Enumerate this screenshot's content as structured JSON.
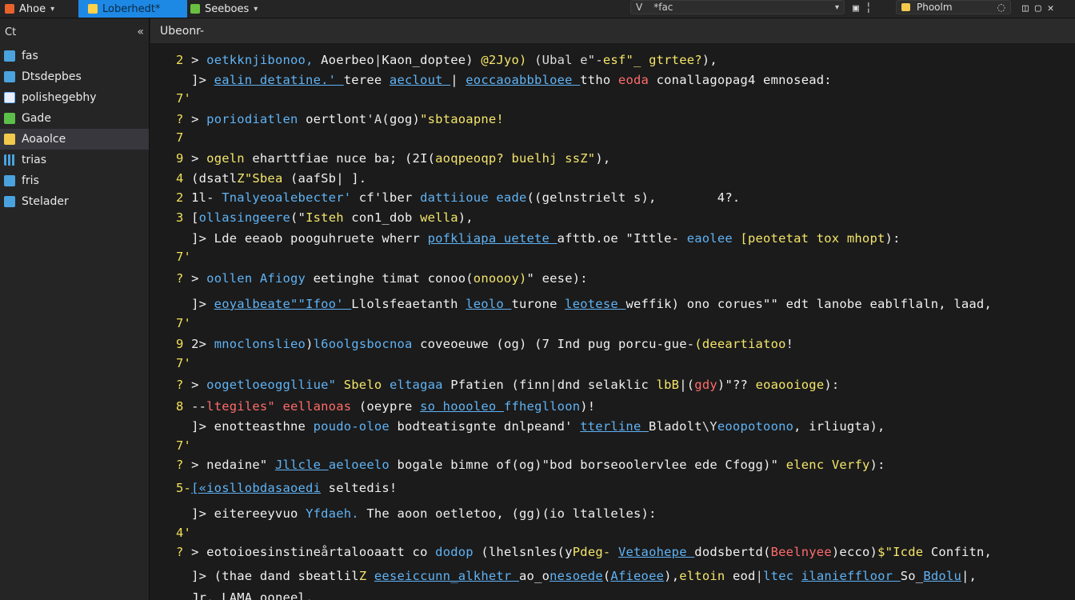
{
  "topbar": {
    "tabs": [
      {
        "label": "Ahoe",
        "color": "#e8622c"
      },
      {
        "label": "Loberhedt*",
        "color": "#ffd24a"
      },
      {
        "label": "Seeboes",
        "color": "#6abf40"
      }
    ],
    "search": {
      "prefix": "V",
      "placeholder": "*fac"
    },
    "branch": {
      "label": "Phoolm"
    }
  },
  "sidebar": {
    "header": "Ct",
    "items": [
      {
        "label": "fas",
        "color": "#4aa3df"
      },
      {
        "label": "Dtsdepbes",
        "color": "#4aa3df"
      },
      {
        "label": "polishegebhy",
        "color": "#6fb3ff"
      },
      {
        "label": "Gade",
        "color": "#5cbf4a"
      },
      {
        "label": "Aoaolce",
        "color": "#f2c94c"
      },
      {
        "label": "trias",
        "color": "#4aa3df"
      },
      {
        "label": "fris",
        "color": "#4aa3df"
      },
      {
        "label": "Stelader",
        "color": "#4aa3df"
      }
    ]
  },
  "editor": {
    "title": "Ubeonr-",
    "lines": [
      [
        [
          "ln",
          "2 "
        ],
        [
          "w",
          "> "
        ],
        [
          "b",
          "oetkknjibonoo, "
        ],
        [
          "w",
          "Aoerbeo"
        ],
        [
          "g",
          "|"
        ],
        [
          "w",
          "Kaon_doptee) "
        ],
        [
          "y",
          "@2Jyo) "
        ],
        [
          "g",
          "(Ubal e\"-"
        ],
        [
          "y",
          "esf\"_ gtrtee?"
        ],
        [
          "w",
          "),"
        ]
      ],
      [
        [
          "w",
          "  ]> "
        ],
        [
          "b",
          "ealin detatine.' "
        ],
        [
          "w",
          "teree "
        ],
        [
          "b",
          "aeclout "
        ],
        [
          "w",
          "| "
        ],
        [
          "b",
          "eoccaoabbbloee "
        ],
        [
          "w",
          "ttho "
        ],
        [
          "r",
          "eoda "
        ],
        [
          "w",
          "conallagopag4 "
        ],
        [
          "w",
          "emnosead:"
        ]
      ],
      [
        [
          "ln",
          "7'"
        ]
      ],
      [
        [
          "ln",
          "? "
        ],
        [
          "w",
          "> "
        ],
        [
          "b",
          "poriodiatlen "
        ],
        [
          "w",
          "oertlont"
        ],
        [
          "g",
          "'A"
        ],
        [
          "w",
          "(gog)"
        ],
        [
          "y",
          "\"sbtaoapne!"
        ]
      ],
      [
        [
          "ln",
          "7"
        ]
      ],
      [
        [
          "ln",
          "9 "
        ],
        [
          "w",
          "> "
        ],
        [
          "y",
          "ogeln "
        ],
        [
          "w",
          "eharttfiae nuce ba; "
        ],
        [
          "w",
          "(2I("
        ],
        [
          "y",
          "aoqpeoqp? buelhj ssZ\""
        ],
        [
          "w",
          "),"
        ]
      ],
      [
        [
          "ln",
          "4 "
        ],
        [
          "w",
          "(dsatl"
        ],
        [
          "y",
          "Z\"Sbea "
        ],
        [
          "w",
          "(aafSb| ]."
        ]
      ],
      [
        [
          "ln",
          "2 "
        ],
        [
          "w",
          "1l- "
        ],
        [
          "b",
          "Tnalyeoalebecter' "
        ],
        [
          "w",
          "cf'lber "
        ],
        [
          "b",
          "dattiioue eade"
        ],
        [
          "w",
          "((gelnstrielt s),        4?."
        ]
      ],
      [
        [
          "ln",
          "3 "
        ],
        [
          "w",
          "["
        ],
        [
          "b",
          "ollasingeere"
        ],
        [
          "w",
          "(\""
        ],
        [
          "y",
          "Isteh "
        ],
        [
          "w",
          "con1_dob "
        ],
        [
          "y",
          "wella"
        ],
        [
          "w",
          "),"
        ]
      ],
      [
        [
          "w",
          "  ]> "
        ],
        [
          "w",
          "Lde "
        ],
        [
          "w",
          "eeaob pooguhruete wherr "
        ],
        [
          "b",
          "pofkliapa uetete "
        ],
        [
          "w",
          "afttb.oe "
        ],
        [
          "w",
          "\"Ittle- "
        ],
        [
          "b",
          "eaolee "
        ],
        [
          "y",
          "[peotetat tox mhopt"
        ],
        [
          "w",
          "):"
        ]
      ],
      [
        [
          "ln",
          "7'"
        ]
      ],
      [
        [
          "ln",
          "? "
        ],
        [
          "w",
          "> "
        ],
        [
          "b",
          "oollen Afiogy "
        ],
        [
          "w",
          "eetinghe timat "
        ],
        [
          "w",
          "conoo("
        ],
        [
          "y",
          "onoooy)"
        ],
        [
          "w",
          "\" eese):"
        ]
      ],
      [
        [
          "w",
          "  ]> "
        ],
        [
          "b",
          "eoyalbeate\"\"Ifoo' "
        ],
        [
          "w",
          "Llolsfeaetanth "
        ],
        [
          "b",
          "leolo "
        ],
        [
          "w",
          "turone "
        ],
        [
          "b",
          "leotese "
        ],
        [
          "w",
          "weffik) ono "
        ],
        [
          "w",
          "corues\"\" "
        ],
        [
          "w",
          "edt lanobe eablflaln, laad,"
        ]
      ],
      [
        [
          "ln",
          "7'"
        ]
      ],
      [
        [
          "ln",
          "9 "
        ],
        [
          "w",
          "2> "
        ],
        [
          "b",
          "mnoclonslieo"
        ],
        [
          "w",
          ")"
        ],
        [
          "b",
          "l6oolgsbocnoa "
        ],
        [
          "w",
          "coveoeuwe "
        ],
        [
          "w",
          "(og) "
        ],
        [
          "w",
          "(7 Ind "
        ],
        [
          "w",
          "pug "
        ],
        [
          "w",
          "porcu-gue-"
        ],
        [
          "y",
          "(deeartiatoo"
        ],
        [
          "w",
          "!"
        ]
      ],
      [
        [
          "ln",
          "7'"
        ]
      ],
      [
        [
          "ln",
          "? "
        ],
        [
          "w",
          "> "
        ],
        [
          "b",
          "oogetloeogglliue\" "
        ],
        [
          "y",
          "Sbelo "
        ],
        [
          "b",
          "eltagaa "
        ],
        [
          "w",
          "Pfatien "
        ],
        [
          "w",
          "(finn"
        ],
        [
          "g",
          "|"
        ],
        [
          "w",
          "dnd selaklic "
        ],
        [
          "y",
          "lbB"
        ],
        [
          "w",
          "|("
        ],
        [
          "r",
          "gdy"
        ],
        [
          "w",
          ")\"?? "
        ],
        [
          "y",
          "eoaooioge"
        ],
        [
          "w",
          "):"
        ]
      ],
      [
        [
          "ln",
          "8 "
        ],
        [
          "w",
          "--"
        ],
        [
          "r",
          "ltegiles\" "
        ],
        [
          "r",
          "eellanoas "
        ],
        [
          "w",
          "(oeypre "
        ],
        [
          "b",
          "so hoooleo "
        ],
        [
          "b",
          "ffheglloon"
        ],
        [
          "w",
          ")!"
        ]
      ],
      [
        [
          "w",
          "  ]> "
        ],
        [
          "w",
          "enotteasthne "
        ],
        [
          "b",
          "poudo-oloe "
        ],
        [
          "w",
          "bodteatisgnte "
        ],
        [
          "w",
          "dnlpeand' "
        ],
        [
          "b",
          "tterline "
        ],
        [
          "w",
          "Bladolt"
        ],
        [
          "g",
          "\\Y"
        ],
        [
          "b",
          "eoopotoono"
        ],
        [
          "w",
          ", irliugta),"
        ]
      ],
      [
        [
          "ln",
          "7'"
        ]
      ],
      [
        [
          "ln",
          "? "
        ],
        [
          "w",
          "> "
        ],
        [
          "w",
          "nedaine\" "
        ],
        [
          "b",
          "Jllcle "
        ],
        [
          "b",
          "aeloeelo "
        ],
        [
          "w",
          "bogale "
        ],
        [
          "w",
          "bimne "
        ],
        [
          "w",
          "of(og)"
        ],
        [
          "w",
          "\"bod "
        ],
        [
          "w",
          "borseoolervlee "
        ],
        [
          "w",
          "ede "
        ],
        [
          "w",
          "Cfogg)\" "
        ],
        [
          "y",
          "elenc Verfy"
        ],
        [
          "w",
          "):"
        ]
      ],
      [
        [
          "ln",
          "5-"
        ],
        [
          "b",
          "[«iosllobdasaoedi"
        ],
        [
          "w",
          " seltedis!"
        ]
      ],
      [
        [
          "w",
          "  ]> "
        ],
        [
          "w",
          "eitereeyvuo "
        ],
        [
          "b",
          "Yfdaeh. "
        ],
        [
          "w",
          "The "
        ],
        [
          "w",
          "aoon "
        ],
        [
          "w",
          "oetletoo, "
        ],
        [
          "w",
          "(gg)"
        ],
        [
          "w",
          "(io "
        ],
        [
          "w",
          "ltalleles):"
        ]
      ],
      [
        [
          "ln",
          "4'"
        ]
      ],
      [
        [
          "ln",
          "? "
        ],
        [
          "w",
          "> "
        ],
        [
          "w",
          "eotoioesinstine"
        ],
        [
          "g",
          "å"
        ],
        [
          "w",
          "rtalooaatt "
        ],
        [
          "w",
          "co "
        ],
        [
          "b",
          "dodop "
        ],
        [
          "w",
          "(lhelsnles(y"
        ],
        [
          "y",
          "Pdeg- "
        ],
        [
          "b",
          "Vetaohepe "
        ],
        [
          "w",
          "dodsbertd("
        ],
        [
          "r",
          "Beelnyee"
        ],
        [
          "w",
          ")ecco)"
        ],
        [
          "y",
          "$\"Icde "
        ],
        [
          "w",
          "Confitn,"
        ]
      ],
      [
        [
          "w",
          "  ]> "
        ],
        [
          "w",
          "(thae "
        ],
        [
          "w",
          "dand "
        ],
        [
          "w",
          "sbeatlil"
        ],
        [
          "y",
          "Z "
        ],
        [
          "b",
          "eeseiccunn_alkhetr "
        ],
        [
          "w",
          "ao_o"
        ],
        [
          "b",
          "nesoede"
        ],
        [
          "w",
          "("
        ],
        [
          "b",
          "Afieoee"
        ],
        [
          "w",
          "),"
        ],
        [
          "y",
          "eltoin "
        ],
        [
          "w",
          "eod"
        ],
        [
          "g",
          "|"
        ],
        [
          "b",
          "ltec "
        ],
        [
          "b",
          "ilanieffloor "
        ],
        [
          "w",
          "So_"
        ],
        [
          "b",
          "Bdolu"
        ],
        [
          "w",
          "|,"
        ]
      ],
      [
        [
          "w",
          "  Jr. "
        ],
        [
          "w",
          "LAMA "
        ],
        [
          "w",
          "ooneel."
        ]
      ]
    ]
  }
}
